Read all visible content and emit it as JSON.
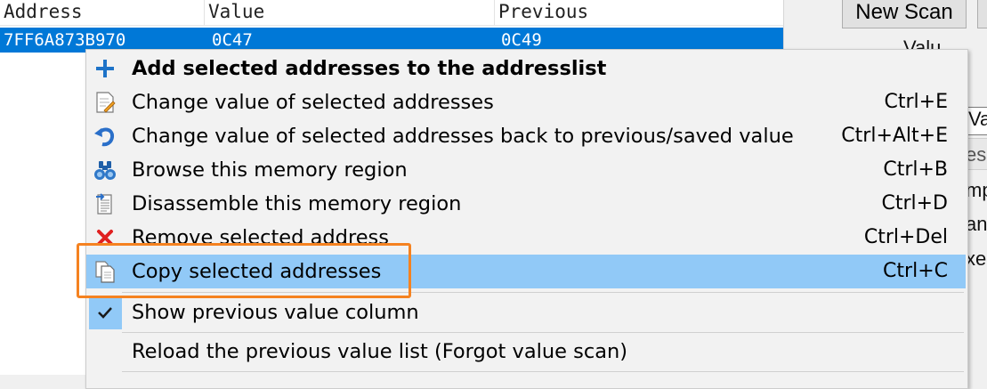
{
  "results": {
    "columns": [
      "Address",
      "Value",
      "Previous"
    ],
    "selected_row": {
      "address": "7FF6A873B970",
      "value": "0C47",
      "previous": "0C49"
    }
  },
  "right_panel": {
    "new_scan_label": "New Scan",
    "peek_texts": [
      "Valu",
      "Va",
      "es",
      "mp",
      "an",
      "xe"
    ]
  },
  "menu": {
    "items": [
      {
        "label": "Add selected addresses to the addresslist",
        "shortcut": "",
        "icon": "plus-icon"
      },
      {
        "label": "Change value of selected addresses",
        "shortcut": "Ctrl+E",
        "icon": "edit-document-icon"
      },
      {
        "label": "Change value of selected addresses back to previous/saved value",
        "shortcut": "Ctrl+Alt+E",
        "icon": "undo-arrow-icon"
      },
      {
        "label": "Browse this memory region",
        "shortcut": "Ctrl+B",
        "icon": "binoculars-icon"
      },
      {
        "label": "Disassemble this memory region",
        "shortcut": "Ctrl+D",
        "icon": "disassemble-document-icon"
      },
      {
        "label": "Remove selected address",
        "shortcut": "Ctrl+Del",
        "icon": "red-x-icon"
      },
      {
        "label": "Copy selected addresses",
        "shortcut": "Ctrl+C",
        "icon": "copy-icon"
      },
      {
        "label": "Show previous value column",
        "shortcut": "",
        "icon": "checkmark-icon"
      },
      {
        "label": "Reload the previous value list (Forgot value scan)",
        "shortcut": "",
        "icon": ""
      }
    ]
  },
  "colors": {
    "selection": "#0078d7",
    "menu_highlight": "#91c9f7",
    "annotation": "#f58220"
  }
}
